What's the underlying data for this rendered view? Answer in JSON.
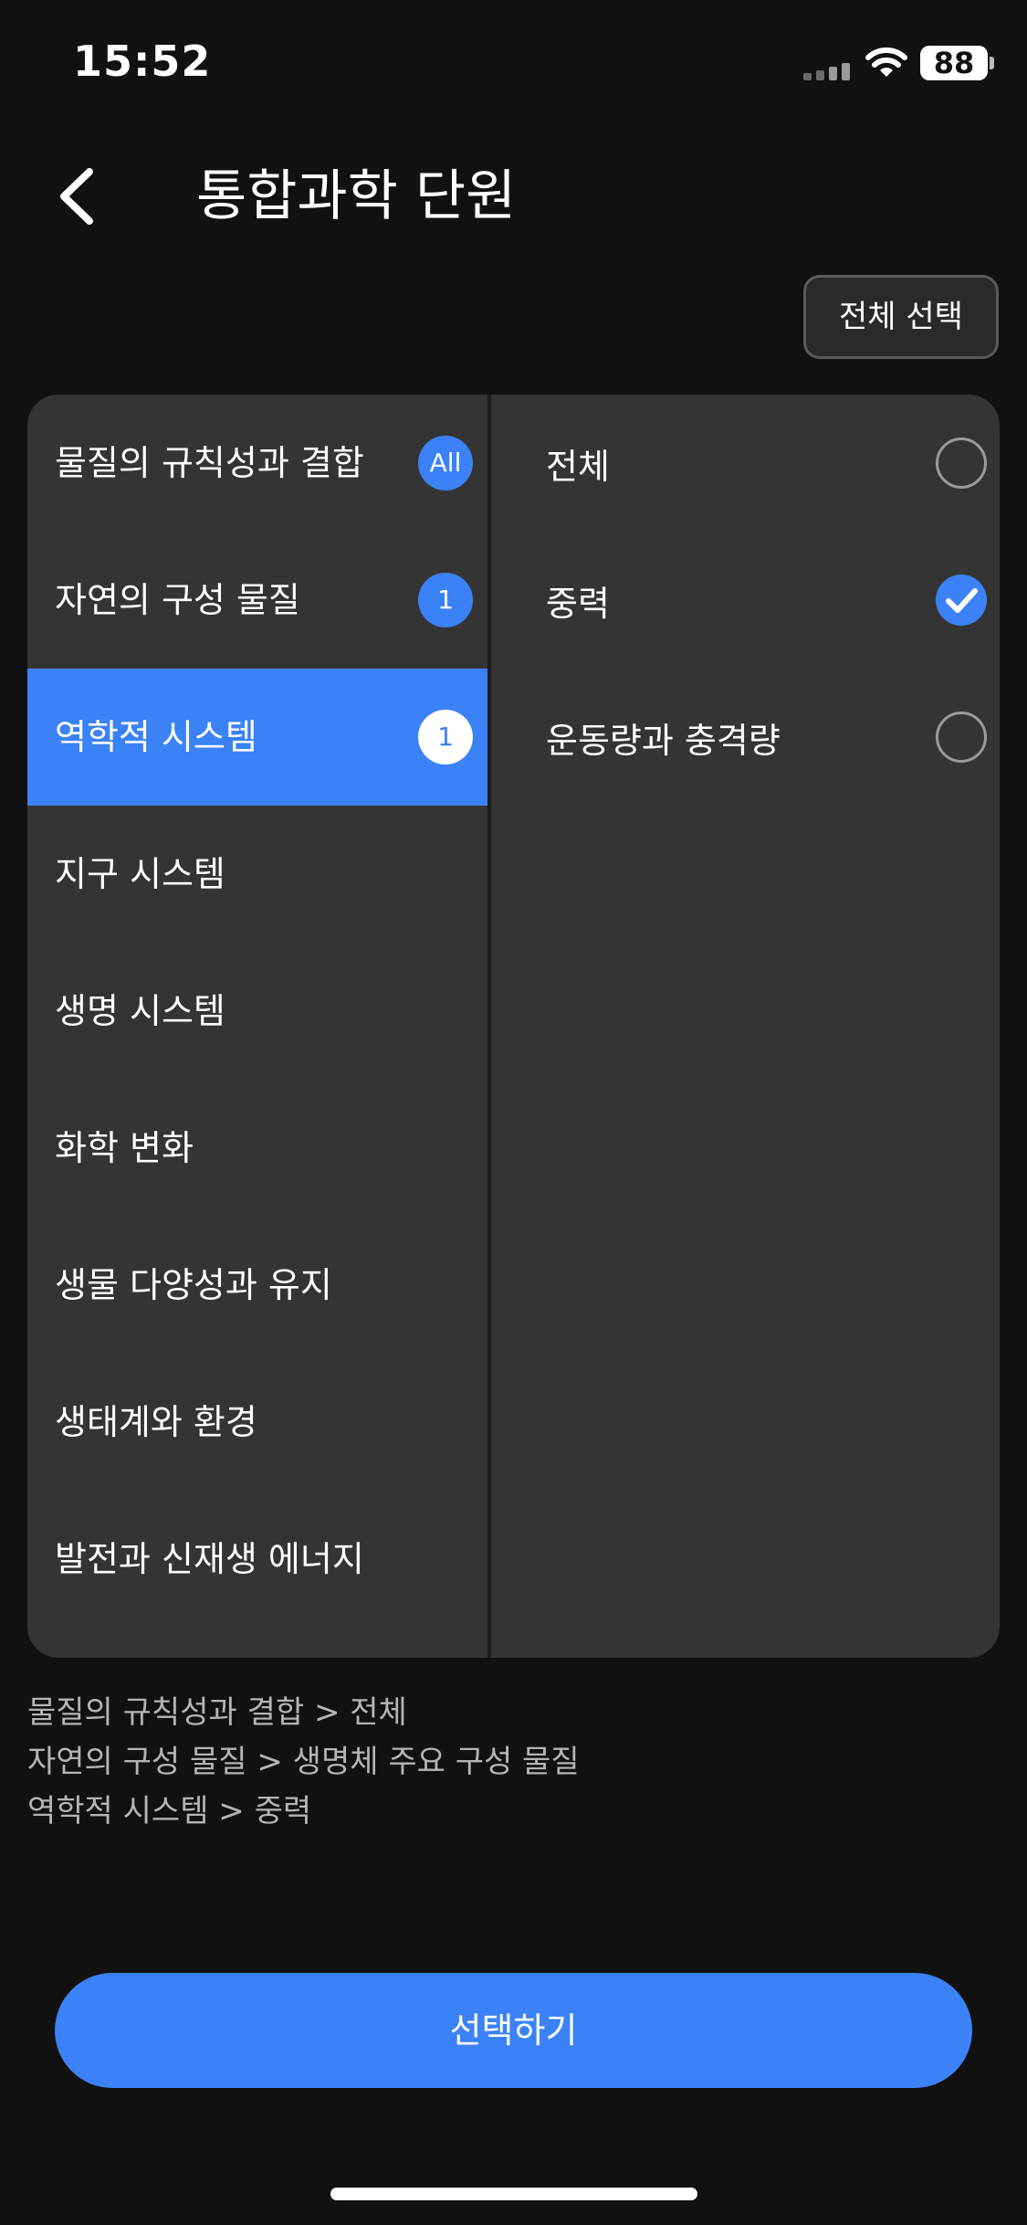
{
  "status_bar": {
    "time": "15:52",
    "battery": "88"
  },
  "header": {
    "title": "통합과학 단원"
  },
  "toolbar": {
    "select_all_label": "전체 선택"
  },
  "categories": [
    {
      "label": "물질의 규칙성과 결합",
      "badge": "All",
      "active": false
    },
    {
      "label": "자연의 구성 물질",
      "badge": "1",
      "active": false
    },
    {
      "label": "역학적 시스템",
      "badge": "1",
      "active": true
    },
    {
      "label": "지구 시스템",
      "badge": "",
      "active": false
    },
    {
      "label": "생명 시스템",
      "badge": "",
      "active": false
    },
    {
      "label": "화학 변화",
      "badge": "",
      "active": false
    },
    {
      "label": "생물 다양성과 유지",
      "badge": "",
      "active": false
    },
    {
      "label": "생태계와 환경",
      "badge": "",
      "active": false
    },
    {
      "label": "발전과 신재생 에너지",
      "badge": "",
      "active": false
    }
  ],
  "subunits": [
    {
      "label": "전체",
      "checked": false
    },
    {
      "label": "중력",
      "checked": true
    },
    {
      "label": "운동량과 충격량",
      "checked": false
    }
  ],
  "summary": [
    "물질의 규칙성과 결합 > 전체",
    "자연의 구성 물질 > 생명체 주요 구성 물질",
    "역학적 시스템 > 중력"
  ],
  "action": {
    "label": "선택하기"
  },
  "colors": {
    "accent": "#3b82f6",
    "background": "#111111",
    "panel": "#343434"
  }
}
